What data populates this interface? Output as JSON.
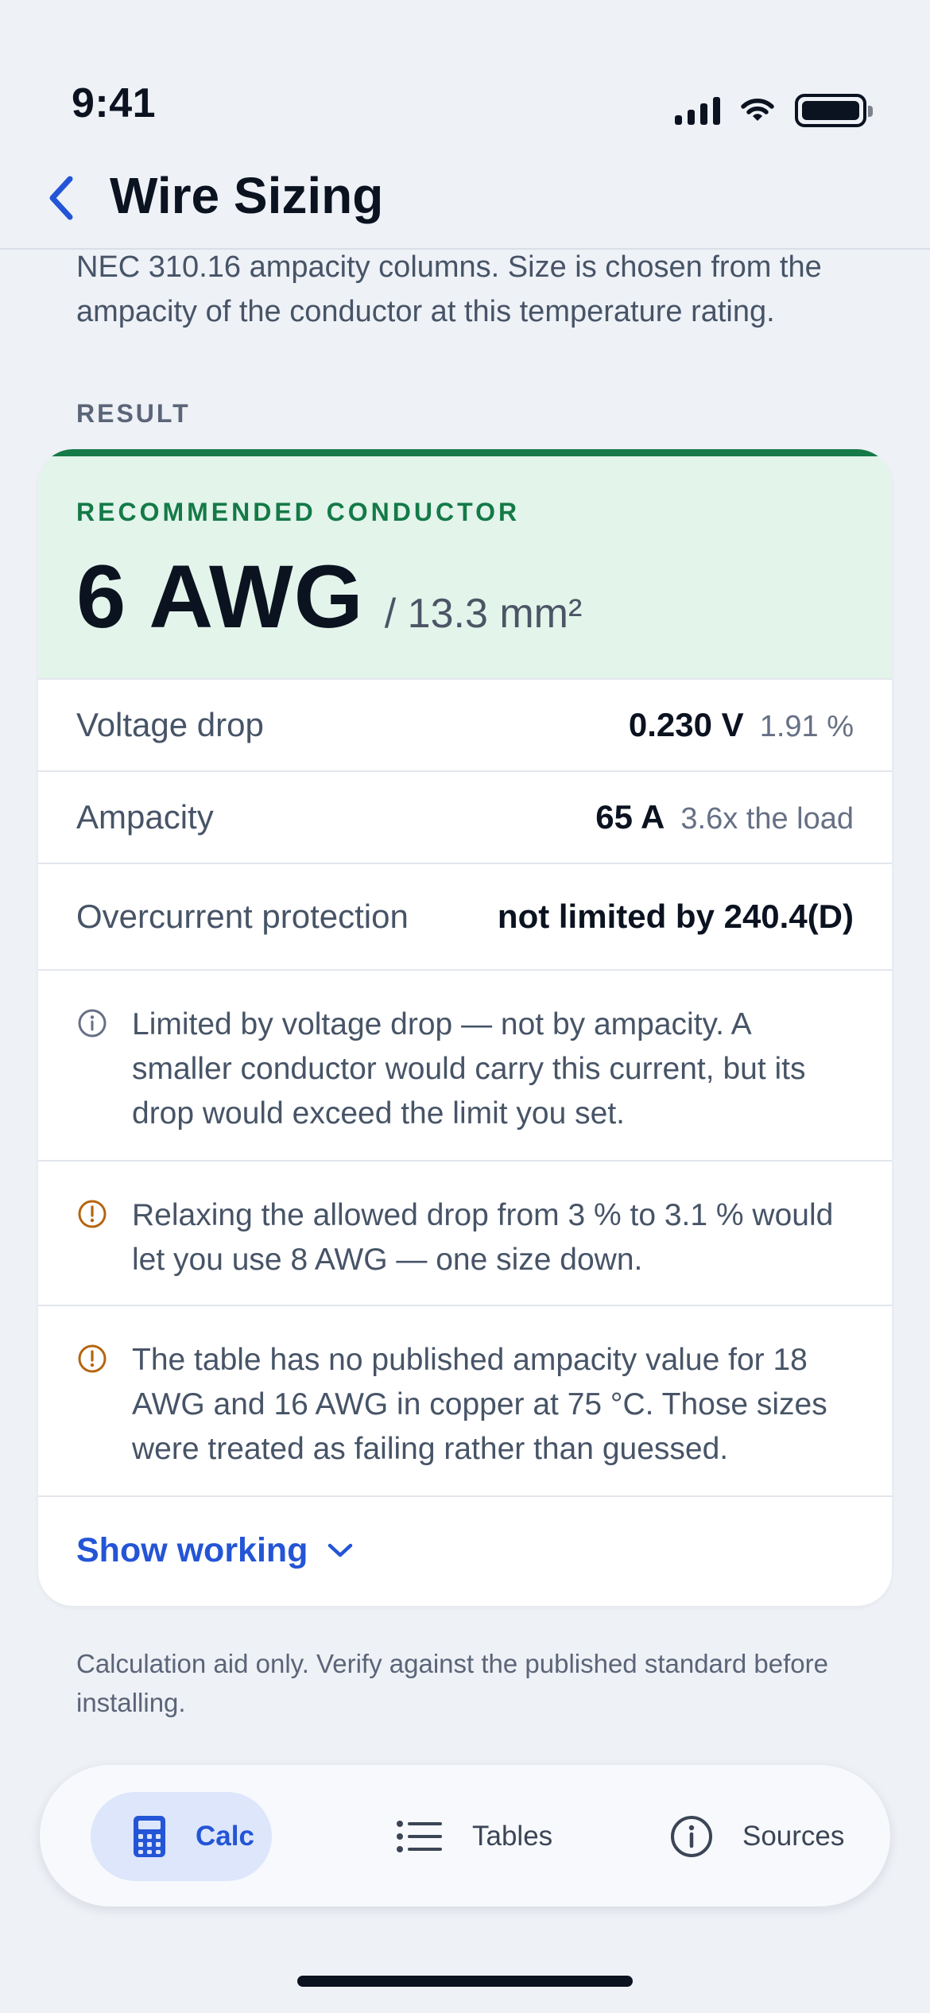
{
  "status_bar": {
    "time": "9:41"
  },
  "nav": {
    "title": "Wire Sizing"
  },
  "intro": {
    "text": "NEC 310.16 ampacity columns. Size is chosen from the ampacity of the conductor at this temperature rating."
  },
  "result": {
    "section_label": "RESULT",
    "hero_label": "RECOMMENDED CONDUCTOR",
    "conductor_size": "6 AWG",
    "metric_size": "/ 13.3 mm²",
    "rows": [
      {
        "label": "Voltage drop",
        "value": "0.230 V",
        "detail": "1.91 %"
      },
      {
        "label": "Ampacity",
        "value": "65 A",
        "detail": "3.6x the load"
      },
      {
        "label": "Overcurrent protection",
        "value": "not limited by 240.4(D)",
        "detail": ""
      }
    ],
    "notes": [
      {
        "icon": "info-icon",
        "text": "Limited by voltage drop — not by ampacity. A smaller conductor would carry this current, but its drop would exceed the limit you set."
      },
      {
        "icon": "warning-icon",
        "text": "Relaxing the allowed drop from 3 % to 3.1 % would let you use 8 AWG — one size down."
      },
      {
        "icon": "warning-icon",
        "text": "The table has no published ampacity value for 18 AWG and 16 AWG in copper at 75 °C. Those sizes were treated as failing rather than guessed."
      }
    ],
    "show_working_label": "Show working"
  },
  "disclaimer": "Calculation aid only. Verify against the published standard before installing.",
  "tab_bar": {
    "tabs": [
      {
        "label": "Calc",
        "icon": "calculator-icon",
        "active": true
      },
      {
        "label": "Tables",
        "icon": "list-icon",
        "active": false
      },
      {
        "label": "Sources",
        "icon": "info-icon",
        "active": false
      }
    ]
  },
  "colors": {
    "accent": "#2455d6",
    "success": "#167a49",
    "warning": "#b5650f",
    "background": "#eef1f6"
  }
}
